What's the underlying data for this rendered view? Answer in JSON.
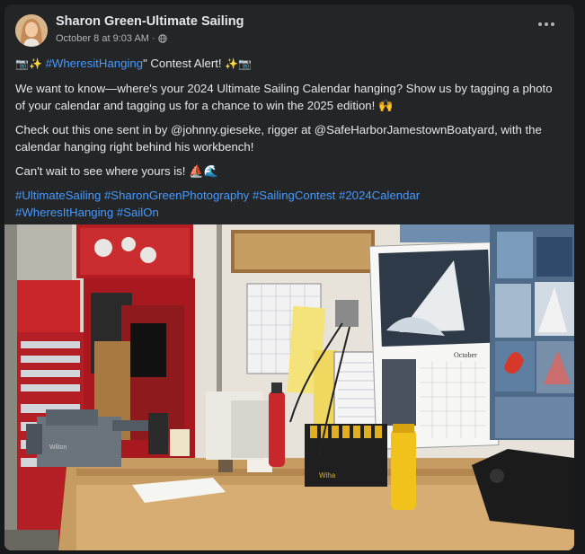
{
  "post": {
    "author": "Sharon Green-Ultimate Sailing",
    "timestamp": "October 8 at 9:03 AM",
    "separator": "·",
    "privacy_icon": "globe-icon",
    "more_icon": "more-options-icon",
    "contest_emoji_left": "📷✨",
    "contest_hashtag": "#WheresitHanging",
    "contest_text": "\" Contest Alert! ",
    "contest_emoji_right": "✨📷",
    "paragraph1": "We want to know—where's your 2024 Ultimate Sailing Calendar hanging? Show us by tagging a photo of your calendar and tagging us for a chance to win the 2025 edition! 🙌",
    "paragraph2": "Check out this one sent in by @johnny.gieseke, rigger at @SafeHarborJamestownBoatyard, with the calendar hanging right behind his workbench!",
    "paragraph3": "Can't wait to see where yours is! ⛵🌊",
    "hashtags": [
      "#UltimateSailing",
      "#SharonGreenPhotography",
      "#SailingContest",
      "#2024Calendar",
      "#WheresItHanging",
      "#SailOn"
    ]
  },
  "photo": {
    "calendar_month": "October",
    "vise_brand": "Wilton",
    "tool_brand": "Wiha"
  },
  "colors": {
    "card_bg": "#242526",
    "page_bg": "#18191a",
    "text": "#e4e6eb",
    "secondary": "#b0b3b8",
    "link": "#4599ff"
  }
}
